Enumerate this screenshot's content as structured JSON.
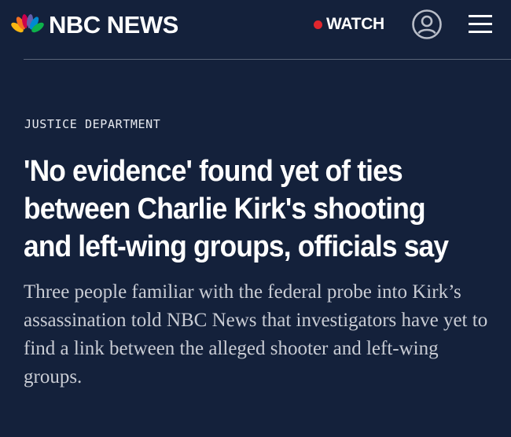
{
  "header": {
    "brand": "NBC NEWS",
    "logo_icon": "nbc-peacock-icon",
    "watch_label": "WATCH",
    "live_dot_color": "#e0262d",
    "account_icon": "user-account-icon",
    "menu_icon": "hamburger-menu-icon"
  },
  "article": {
    "category": "JUSTICE DEPARTMENT",
    "headline": "'No evidence' found yet of ties between Charlie Kirk's shooting and left-wing groups, officials say",
    "dek": "Three people familiar with the federal probe into Kirk’s assassination told NBC News that investigators have yet to find a link between the alleged shooter and left-wing groups."
  },
  "colors": {
    "background": "#14213b",
    "text": "#ffffff",
    "dek_text": "#c9ccd4",
    "divider": "#5a6478",
    "peacock": [
      "#fcb711",
      "#f37021",
      "#cc004c",
      "#6460aa",
      "#0089d0",
      "#0db14b"
    ]
  }
}
